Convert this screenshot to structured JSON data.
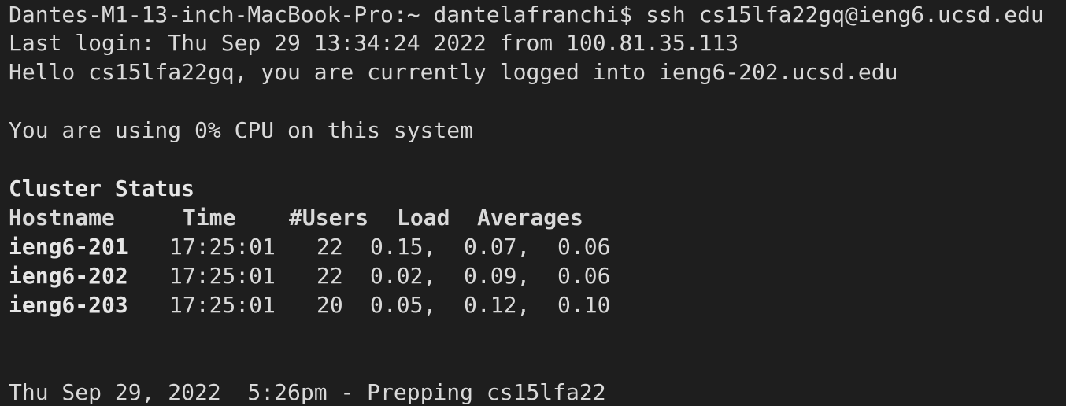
{
  "terminal": {
    "ssh_command_line": "Dantes-M1-13-inch-MacBook-Pro:~ dantelafranchi$ ssh cs15lfa22gq@ieng6.ucsd.edu",
    "last_login": "Last login: Thu Sep 29 13:34:24 2022 from 100.81.35.113",
    "hello_line": "Hello cs15lfa22gq, you are currently logged into ieng6-202.ucsd.edu",
    "cpu_line": "You are using 0% CPU on this system",
    "cluster_title": "Cluster Status",
    "table": {
      "headers": {
        "hostname": "Hostname",
        "time": "Time",
        "users": "#Users",
        "load": "Load",
        "averages": "Averages"
      },
      "rows": [
        {
          "hostname": "ieng6-201",
          "time": "17:25:01",
          "users": "22",
          "l1": "0.15,",
          "l5": "0.07,",
          "l15": "0.06"
        },
        {
          "hostname": "ieng6-202",
          "time": "17:25:01",
          "users": "22",
          "l1": "0.02,",
          "l5": "0.09,",
          "l15": "0.06"
        },
        {
          "hostname": "ieng6-203",
          "time": "17:25:01",
          "users": "20",
          "l1": "0.05,",
          "l5": "0.12,",
          "l15": "0.10"
        }
      ]
    },
    "prepping_line": "Thu Sep 29, 2022  5:26pm - Prepping cs15lfa22"
  }
}
